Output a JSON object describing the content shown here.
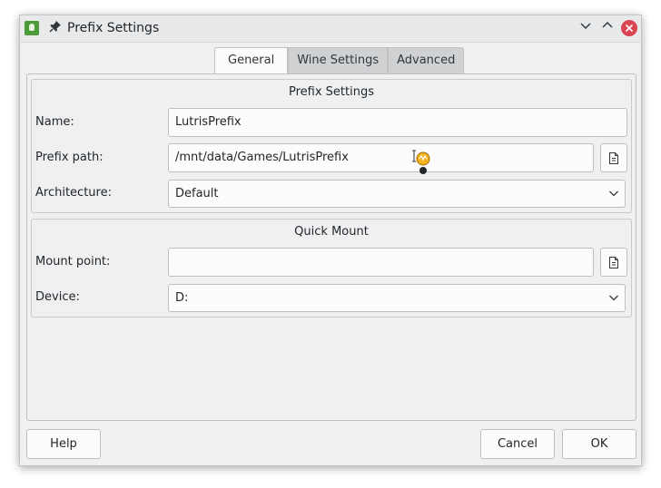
{
  "window": {
    "title": "Prefix Settings",
    "icons": {
      "app": "lutris-app-icon",
      "pin": "pin-icon",
      "minimize": "chevron-down-icon",
      "maximize": "chevron-up-icon",
      "close": "close-icon"
    },
    "controls": {
      "minimize": "⌄",
      "maximize": "⌃",
      "close": "✕",
      "pin": "📌"
    }
  },
  "tabs": [
    {
      "label": "General",
      "active": true
    },
    {
      "label": "Wine Settings",
      "active": false
    },
    {
      "label": "Advanced",
      "active": false
    }
  ],
  "prefix_settings": {
    "title": "Prefix Settings",
    "name_label": "Name:",
    "name_value": "LutrisPrefix",
    "path_label": "Prefix path:",
    "path_value": "/mnt/data/Games/LutrisPrefix",
    "arch_label": "Architecture:",
    "arch_value": "Default"
  },
  "quick_mount": {
    "title": "Quick Mount",
    "mount_label": "Mount point:",
    "mount_value": "",
    "device_label": "Device:",
    "device_value": "D:"
  },
  "buttons": {
    "help": "Help",
    "cancel": "Cancel",
    "ok": "OK"
  },
  "colors": {
    "window_bg": "#eff0f1",
    "field_bg": "#fcfcfc",
    "close_red": "#da4453",
    "text": "#232629"
  }
}
